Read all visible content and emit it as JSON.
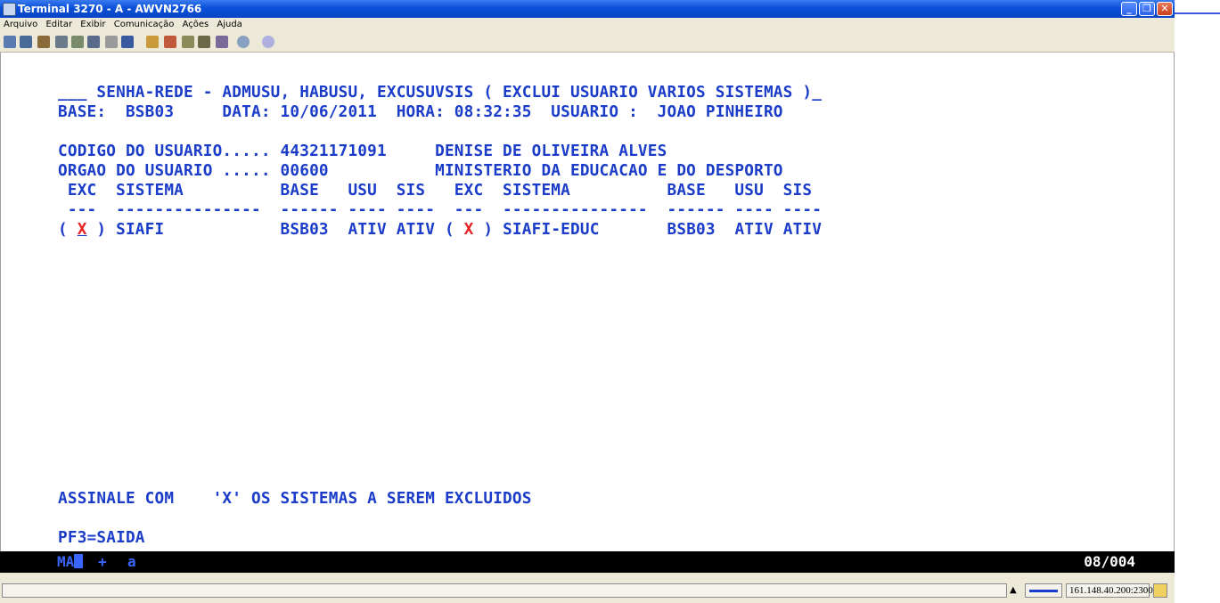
{
  "window": {
    "title": "Terminal 3270 - A - AWVN2766",
    "minimize": "_",
    "maximize": "❐",
    "close": "✕"
  },
  "menu": [
    "Arquivo",
    "Editar",
    "Exibir",
    "Comunicação",
    "Ações",
    "Ajuda"
  ],
  "toolbar_icons": [
    "copy-icon",
    "paste-icon",
    "send-icon",
    "print-icon",
    "print-screen-icon",
    "print-window-icon",
    "macro-icon",
    "keypad-icon",
    "transfer-up-icon",
    "transfer-down-icon",
    "receive-icon",
    "send-file-icon",
    "connect-icon",
    "disconnect-icon",
    "help-icon"
  ],
  "screen": {
    "line1": "___ SENHA-REDE - ADMUSU, HABUSU, EXCUSUVSIS ( EXCLUI USUARIO VARIOS SISTEMAS )_",
    "line2": "BASE:  BSB03     DATA: 10/06/2011  HORA: 08:32:35  USUARIO :  JOAO PINHEIRO",
    "line3": "CODIGO DO USUARIO..... 44321171091     DENISE DE OLIVEIRA ALVES",
    "line4": "ORGAO DO USUARIO ..... 00600           MINISTERIO DA EDUCACAO E DO DESPORTO",
    "line5": " EXC  SISTEMA          BASE   USU  SIS   EXC  SISTEMA          BASE   USU  SIS",
    "line6": " ---  ---------------  ------ ---- ----  ---  ---------------  ------ ---- ----",
    "row": {
      "open1": "( ",
      "mark1": "X",
      "close1": " ) SIAFI            BSB03  ATIV ATIV ( ",
      "mark2": "X",
      "close2": " ) SIAFI-EDUC       BSB03  ATIV ATIV"
    },
    "instruction": "ASSINALE COM    'X' OS SISTEMAS A SEREM EXCLUIDOS",
    "pfkeys": "PF3=SAIDA"
  },
  "oia": {
    "ma": "MA",
    "plus": "+",
    "a": "a",
    "cursor_position": "08/004"
  },
  "status": {
    "arrow": "▲",
    "host": "161.148.40.200:23000"
  },
  "colors": {
    "field_text": "#1a3cc8",
    "selection": "#e82020",
    "titlebar": "#0a50d8"
  }
}
